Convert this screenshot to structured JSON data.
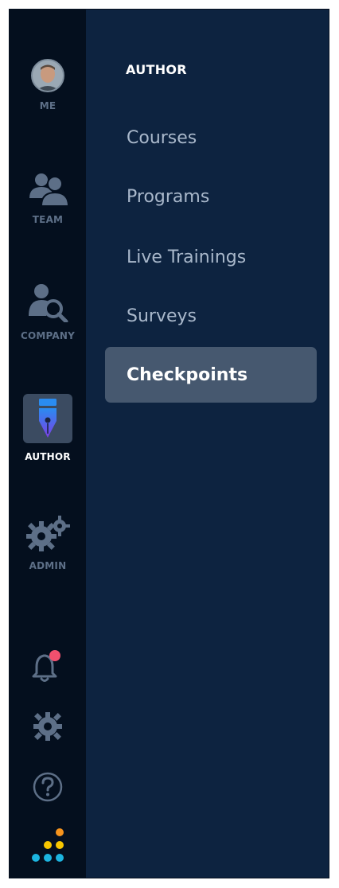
{
  "rail": {
    "items": [
      {
        "label": "ME",
        "icon": "avatar"
      },
      {
        "label": "TEAM",
        "icon": "team-icon"
      },
      {
        "label": "COMPANY",
        "icon": "company-search-icon"
      },
      {
        "label": "AUTHOR",
        "icon": "pen-nib-icon",
        "active": true
      },
      {
        "label": "ADMIN",
        "icon": "gears-icon"
      }
    ],
    "bottom_icons": [
      "bell-icon",
      "settings-icon",
      "help-icon",
      "brand-logo"
    ]
  },
  "panel": {
    "title": "AUTHOR",
    "items": [
      {
        "label": "Courses"
      },
      {
        "label": "Programs"
      },
      {
        "label": "Live Trainings"
      },
      {
        "label": "Surveys"
      },
      {
        "label": "Checkpoints",
        "active": true
      }
    ]
  },
  "colors": {
    "rail_bg": "#040f1e",
    "panel_bg": "#0d2340",
    "active_item_bg": "#46586f",
    "icon_gray": "#5d6f87",
    "notification_dot": "#f0506e",
    "logo_orange": "#f7941d",
    "logo_yellow": "#f7c600",
    "logo_cyan": "#1cb5e0"
  }
}
